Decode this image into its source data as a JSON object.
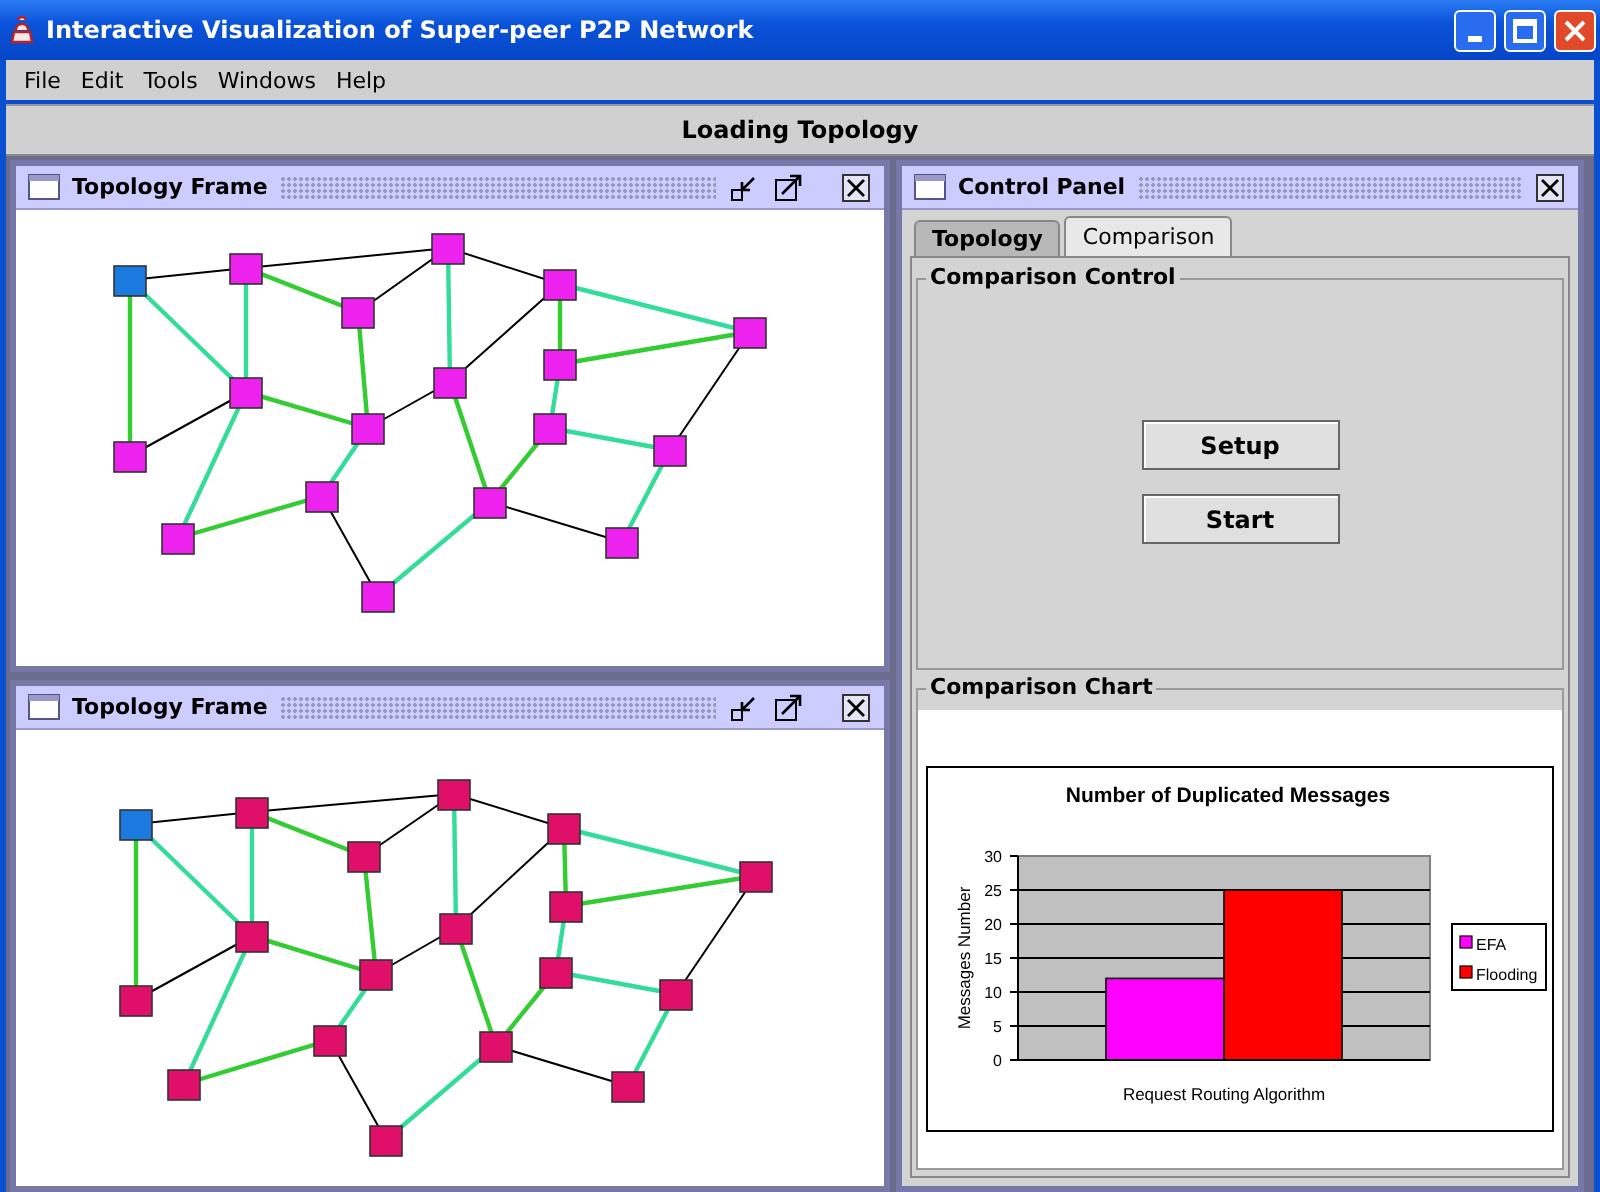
{
  "window": {
    "title": "Interactive Visualization of Super-peer P2P Network"
  },
  "menu": [
    "File",
    "Edit",
    "Tools",
    "Windows",
    "Help"
  ],
  "status": "Loading Topology",
  "topology_frames": [
    {
      "title": "Topology Frame"
    },
    {
      "title": "Topology Frame"
    }
  ],
  "control_panel": {
    "title": "Control Panel",
    "tabs": [
      {
        "label": "Topology",
        "selected": false
      },
      {
        "label": "Comparison",
        "selected": true
      }
    ],
    "comparison_control": {
      "title": "Comparison Control",
      "buttons": [
        "Setup",
        "Start"
      ]
    },
    "comparison_chart": {
      "title": "Comparison Chart",
      "chart_data": {
        "type": "bar",
        "title": "Number of Duplicated Messages",
        "xlabel": "Request Routing Algorithm",
        "ylabel": "Messages Number",
        "grid": true,
        "legend": true,
        "ylim": [
          0,
          30
        ],
        "yticks": [
          0,
          5,
          10,
          15,
          20,
          25,
          30
        ],
        "series": [
          {
            "name": "EFA",
            "color": "#ff00ff",
            "values": [
              12
            ]
          },
          {
            "name": "Flooding",
            "color": "#ff0000",
            "values": [
              25
            ]
          }
        ]
      }
    }
  }
}
